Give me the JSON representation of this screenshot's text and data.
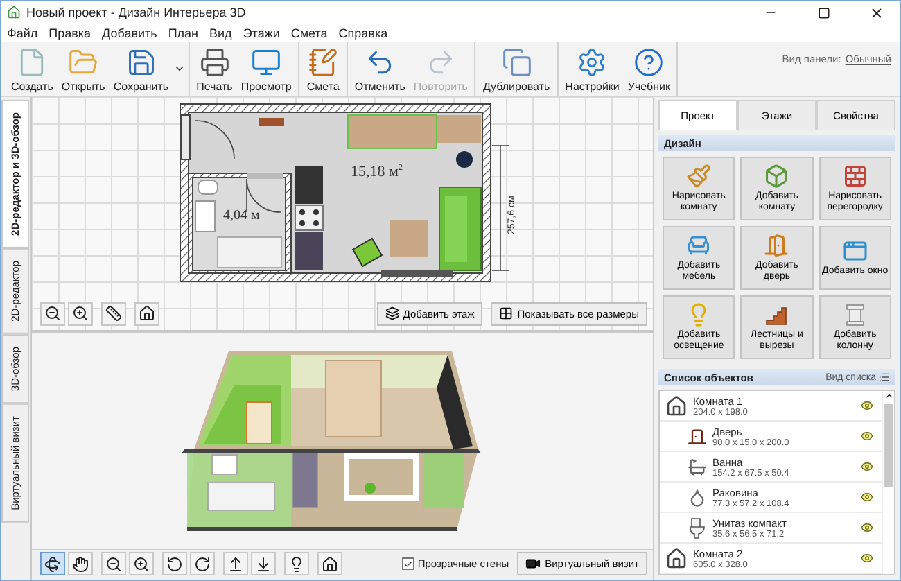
{
  "window": {
    "title": "Новый проект - Дизайн Интерьера 3D"
  },
  "menu": [
    "Файл",
    "Правка",
    "Добавить",
    "План",
    "Вид",
    "Этажи",
    "Смета",
    "Справка"
  ],
  "toolbar": {
    "groups": [
      [
        {
          "kind": "new",
          "label": "Создать",
          "disabled": false
        },
        {
          "kind": "open",
          "label": "Открыть",
          "disabled": false
        },
        {
          "kind": "save",
          "label": "Сохранить",
          "disabled": false,
          "has_menu": true
        }
      ],
      [
        {
          "kind": "print",
          "label": "Печать",
          "disabled": false
        },
        {
          "kind": "preview",
          "label": "Просмотр",
          "disabled": false
        }
      ],
      [
        {
          "kind": "estimate",
          "label": "Смета",
          "disabled": false
        }
      ],
      [
        {
          "kind": "undo",
          "label": "Отменить",
          "disabled": false
        },
        {
          "kind": "redo",
          "label": "Повторить",
          "disabled": true
        }
      ],
      [
        {
          "kind": "duplicate",
          "label": "Дублировать",
          "disabled": false
        }
      ],
      [
        {
          "kind": "settings",
          "label": "Настройки",
          "disabled": false
        },
        {
          "kind": "help",
          "label": "Учебник",
          "disabled": false
        }
      ]
    ],
    "panel_view_label": "Вид панели:",
    "panel_view_link": "Обычный"
  },
  "side_tabs": [
    {
      "label": "2D-редактор и 3D-обзор",
      "selected": true
    },
    {
      "label": "2D-редактор",
      "selected": false
    },
    {
      "label": "3D-обзор",
      "selected": false
    },
    {
      "label": "Виртуальный визит",
      "selected": false
    }
  ],
  "plan2d": {
    "main_area": "15,18 м$^{2}$",
    "bath_area": "4,04 м",
    "dimension": "257,6 см",
    "tool_groups": [
      [
        {
          "kind": "zoom_out",
          "selected": false
        },
        {
          "kind": "zoom_in",
          "selected": false
        }
      ],
      [
        {
          "kind": "ruler",
          "selected": false
        }
      ],
      [
        {
          "kind": "home",
          "selected": false
        }
      ]
    ],
    "buttons": [
      {
        "kind": "add_floor",
        "label": "Добавить этаж"
      },
      {
        "kind": "dimensions",
        "label": "Показывать все размеры"
      }
    ]
  },
  "view3d": {
    "tool_groups": [
      [
        {
          "kind": "orbit",
          "selected": true
        },
        {
          "kind": "pan",
          "selected": false
        }
      ],
      [
        {
          "kind": "zoom_out",
          "selected": false
        },
        {
          "kind": "zoom_in",
          "selected": false
        }
      ],
      [
        {
          "kind": "rotate_left",
          "selected": false
        },
        {
          "kind": "rotate_right",
          "selected": false
        }
      ],
      [
        {
          "kind": "tilt_up",
          "selected": false
        },
        {
          "kind": "tilt_down",
          "selected": false
        }
      ],
      [
        {
          "kind": "light",
          "selected": false
        }
      ],
      [
        {
          "kind": "home",
          "selected": false
        }
      ]
    ],
    "transparent_walls": {
      "label": "Прозрачные стены",
      "checked": true
    },
    "visit_button": "Виртуальный визит"
  },
  "right_panel": {
    "tabs": [
      {
        "label": "Проект",
        "selected": true
      },
      {
        "label": "Этажи",
        "selected": false
      },
      {
        "label": "Свойства",
        "selected": false
      }
    ],
    "design_title": "Дизайн",
    "design_buttons": [
      {
        "kind": "draw_room",
        "label": "Нарисовать комнату"
      },
      {
        "kind": "add_room",
        "label": "Добавить комнату"
      },
      {
        "kind": "partition",
        "label": "Нарисовать перегородку"
      },
      {
        "kind": "furniture",
        "label": "Добавить мебель"
      },
      {
        "kind": "door",
        "label": "Добавить дверь"
      },
      {
        "kind": "window",
        "label": "Добавить окно"
      },
      {
        "kind": "lighting",
        "label": "Добавить освещение"
      },
      {
        "kind": "stairs",
        "label": "Лестницы и вырезы"
      },
      {
        "kind": "column",
        "label": "Добавить колонну"
      }
    ],
    "objects_title": "Список объектов",
    "list_view": "Вид списка",
    "objects": [
      {
        "kind": "room",
        "name": "Комната 1",
        "size": "204.0 x 198.0",
        "children": [
          {
            "kind": "door",
            "name": "Дверь",
            "size": "90.0 x 15.0 x 200.0"
          },
          {
            "kind": "bath",
            "name": "Ванна",
            "size": "154.2 x 67.5 x 50.4"
          },
          {
            "kind": "sink",
            "name": "Раковина",
            "size": "77.3 x 57.2 x 108.4"
          },
          {
            "kind": "toilet",
            "name": "Унитаз компакт",
            "size": "35.6 x 56.5 x 71.2"
          }
        ]
      },
      {
        "kind": "room",
        "name": "Комната 2",
        "size": "605.0 x 328.0"
      }
    ]
  }
}
